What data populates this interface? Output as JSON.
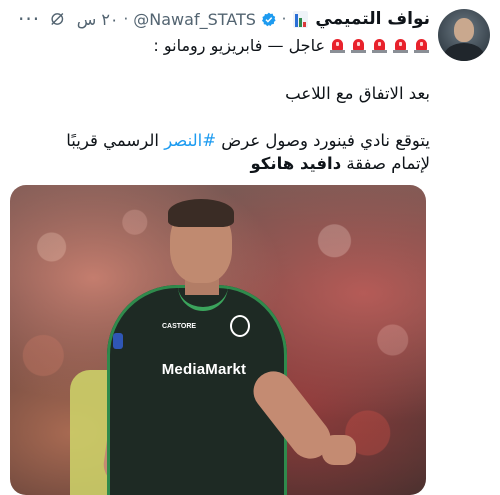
{
  "tweet": {
    "author_name": "نواف التميمي",
    "handle": "@Nawaf_STATS",
    "separator": "·",
    "time": "٢٠ س",
    "more_label": "···",
    "headline_text": "عاجل — فابريزيو رومانو :",
    "siren_count": 5,
    "paragraph1": "بعد الاتفاق مع اللاعب",
    "paragraph2_before": "يتوقع نادي فينورد وصول عرض ",
    "hashtag": "#النصر",
    "paragraph2_after": " الرسمي قريبًا",
    "paragraph3_before": "لإتمام صفقة ",
    "paragraph3_bold": "دافيد هانكو"
  },
  "media": {
    "sponsor_text": "MediaMarkt",
    "brand_text": "CASTORE"
  },
  "icons": {
    "avatar": "avatar-photo",
    "bars": "bar-chart-emoji",
    "verified": "verified-badge-icon",
    "grok": "grok-icon",
    "siren": "police-light-emoji"
  },
  "colors": {
    "verified": "#1d9bf0",
    "hashtag": "#1d9bf0",
    "muted": "#536471",
    "siren": "#e8222c",
    "kit_trim": "#3ba45c"
  }
}
